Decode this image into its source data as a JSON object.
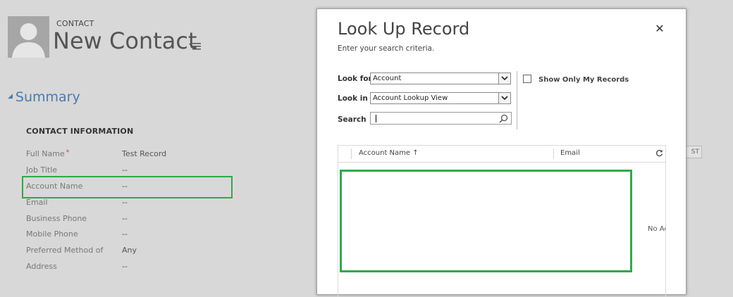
{
  "form": {
    "entity_label": "CONTACT",
    "title": "New Contact",
    "section_header": "Summary",
    "info_title": "CONTACT INFORMATION",
    "fields": [
      {
        "label": "Full Name",
        "value": "Test Record",
        "required": true
      },
      {
        "label": "Job Title",
        "value": "--"
      },
      {
        "label": "Account Name",
        "value": "--"
      },
      {
        "label": "Email",
        "value": "--"
      },
      {
        "label": "Business Phone",
        "value": "--"
      },
      {
        "label": "Mobile Phone",
        "value": "--"
      },
      {
        "label": "Preferred Method of C",
        "value": "Any"
      },
      {
        "label": "Address",
        "value": "--"
      }
    ],
    "required_marker": "*",
    "partial_button": "ST"
  },
  "dialog": {
    "title": "Look Up Record",
    "subtitle": "Enter your search criteria.",
    "close_glyph": "✕",
    "look_for": {
      "label": "Look for",
      "value": "Account"
    },
    "look_in": {
      "label": "Look in",
      "value": "Account Lookup View"
    },
    "search": {
      "label": "Search",
      "value": ""
    },
    "show_only_mine": {
      "label": "Show Only My Records",
      "checked": false
    },
    "grid": {
      "columns": [
        {
          "label": "Account Name ↑",
          "sorted": "ascending"
        },
        {
          "label": "Email"
        }
      ],
      "empty_text": "No Ac"
    }
  },
  "colors": {
    "highlight": "#2eaa4a",
    "section_header": "#4a7ab0",
    "required": "#d9302c",
    "overlay_background": "#d8d8d8"
  },
  "icons": [
    "avatar-icon",
    "menu-icon",
    "close-icon",
    "dropdown-arrow-icon",
    "search-icon",
    "refresh-icon"
  ]
}
